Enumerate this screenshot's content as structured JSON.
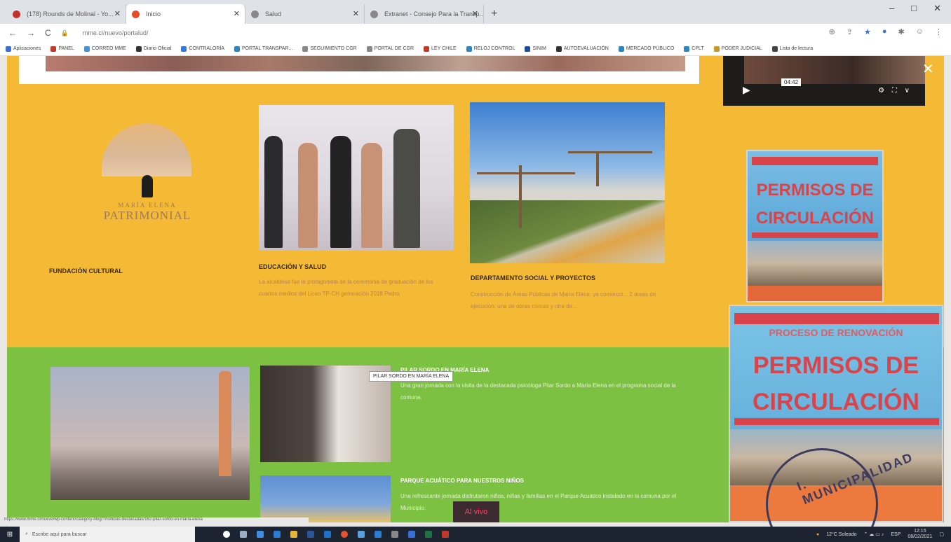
{
  "browser": {
    "tabs": [
      {
        "title": "(178) Rounds de Molinal - Yo...",
        "favicon_color": "#c4302b"
      },
      {
        "title": "Inicio",
        "favicon_color": "#e44c2a"
      },
      {
        "title": "Salud",
        "favicon_color": "#666666"
      },
      {
        "title": "Extranet - Consejo Para la Transp...",
        "favicon_color": "#666666"
      }
    ],
    "new_tab": "+",
    "window_controls": {
      "min": "–",
      "max": "□",
      "close": "✕"
    },
    "nav": {
      "back": "←",
      "forward": "→",
      "reload": "C"
    },
    "url": "mme.cl/nuevo/portalud/",
    "bookmarks": [
      {
        "label": "Aplicaciones",
        "color": "#3b6fd0"
      },
      {
        "label": "PANEL",
        "color": "#c0392b"
      },
      {
        "label": "CORREO MME",
        "color": "#4a90d9"
      },
      {
        "label": "Diario Oficial",
        "color": "#333333"
      },
      {
        "label": "CONTRALORÍA",
        "color": "#3a7bd5"
      },
      {
        "label": "PORTAL TRANSPAR...",
        "color": "#2e86c1"
      },
      {
        "label": "SEGUIMIENTO CGR",
        "color": "#888888"
      },
      {
        "label": "PORTAL DE CGR",
        "color": "#888888"
      },
      {
        "label": "LEY CHILE",
        "color": "#c0392b"
      },
      {
        "label": "RELOJ CONTROL",
        "color": "#2e86c1"
      },
      {
        "label": "SINIM",
        "color": "#1f4e9e"
      },
      {
        "label": "AUTOEVALUACIÓN",
        "color": "#333333"
      },
      {
        "label": "MERCADO PÚBLICO",
        "color": "#2e86c1"
      },
      {
        "label": "CPLT",
        "color": "#2e86c1"
      },
      {
        "label": "PODER JUDICIAL",
        "color": "#c59a2a"
      },
      {
        "label": "Lista de lectura",
        "color": "#444444"
      }
    ]
  },
  "page": {
    "video": {
      "time": "04:42",
      "controls": "⚙ ⛶ ∨",
      "close": "✕"
    },
    "logo": {
      "subtitle": "MARÍA ELENA",
      "title": "PATRIMONIAL"
    },
    "cards": [
      {
        "title": "FUNDACIÓN CULTURAL",
        "text": ""
      },
      {
        "title": "EDUCACIÓN Y SALUD",
        "text": "La alcaldesa fue la protagonista de la ceremonia de graduación de los cuartos medios del Liceo TP-CH generación 2018 Pedro."
      },
      {
        "title": "DEPARTAMENTO SOCIAL Y PROYECTOS",
        "text": "Construcción de Áreas Públicas de María Elena: ya comenzó... 2 áreas de ejecución, una de obras cívicas y otra de..."
      }
    ],
    "banner_small": {
      "line1": "PERMISOS DE",
      "line2": "CIRCULACIÓN"
    },
    "banner_big": {
      "top": "PROCESO DE RENOVACIÓN",
      "line1": "PERMISOS DE",
      "line2": "CIRCULACIÓN"
    },
    "news": [
      {
        "title": "PILAR SORDO EN MARÍA ELENA",
        "text": "Una gran jornada con la visita de la destacada psicóloga Pilar Sordo a María Elena en el programa social de la comuna."
      },
      {
        "title": "PARQUE ACUÁTICO PARA NUESTROS NIÑOS",
        "text": "Una refrescante jornada disfrutaron niños, niñas y familias en el Parque Acuático instalado en la comuna por el Municipio."
      }
    ],
    "tooltip": "PILAR SORDO EN MARÍA ELENA",
    "live_badge": "Al vivo",
    "stamp": "I. MUNICIPALIDAD",
    "status_url": "https://www.mme.cl/nuevo/wp-content/category-blog/?/noticias-destacadas/162-pilar-sordo-en-maria-elena"
  },
  "taskbar": {
    "search_placeholder": "Escribe aquí para buscar",
    "weather": "12°C Soleado",
    "lang": "ESP",
    "time": "12:15",
    "date": "08/02/2021"
  }
}
